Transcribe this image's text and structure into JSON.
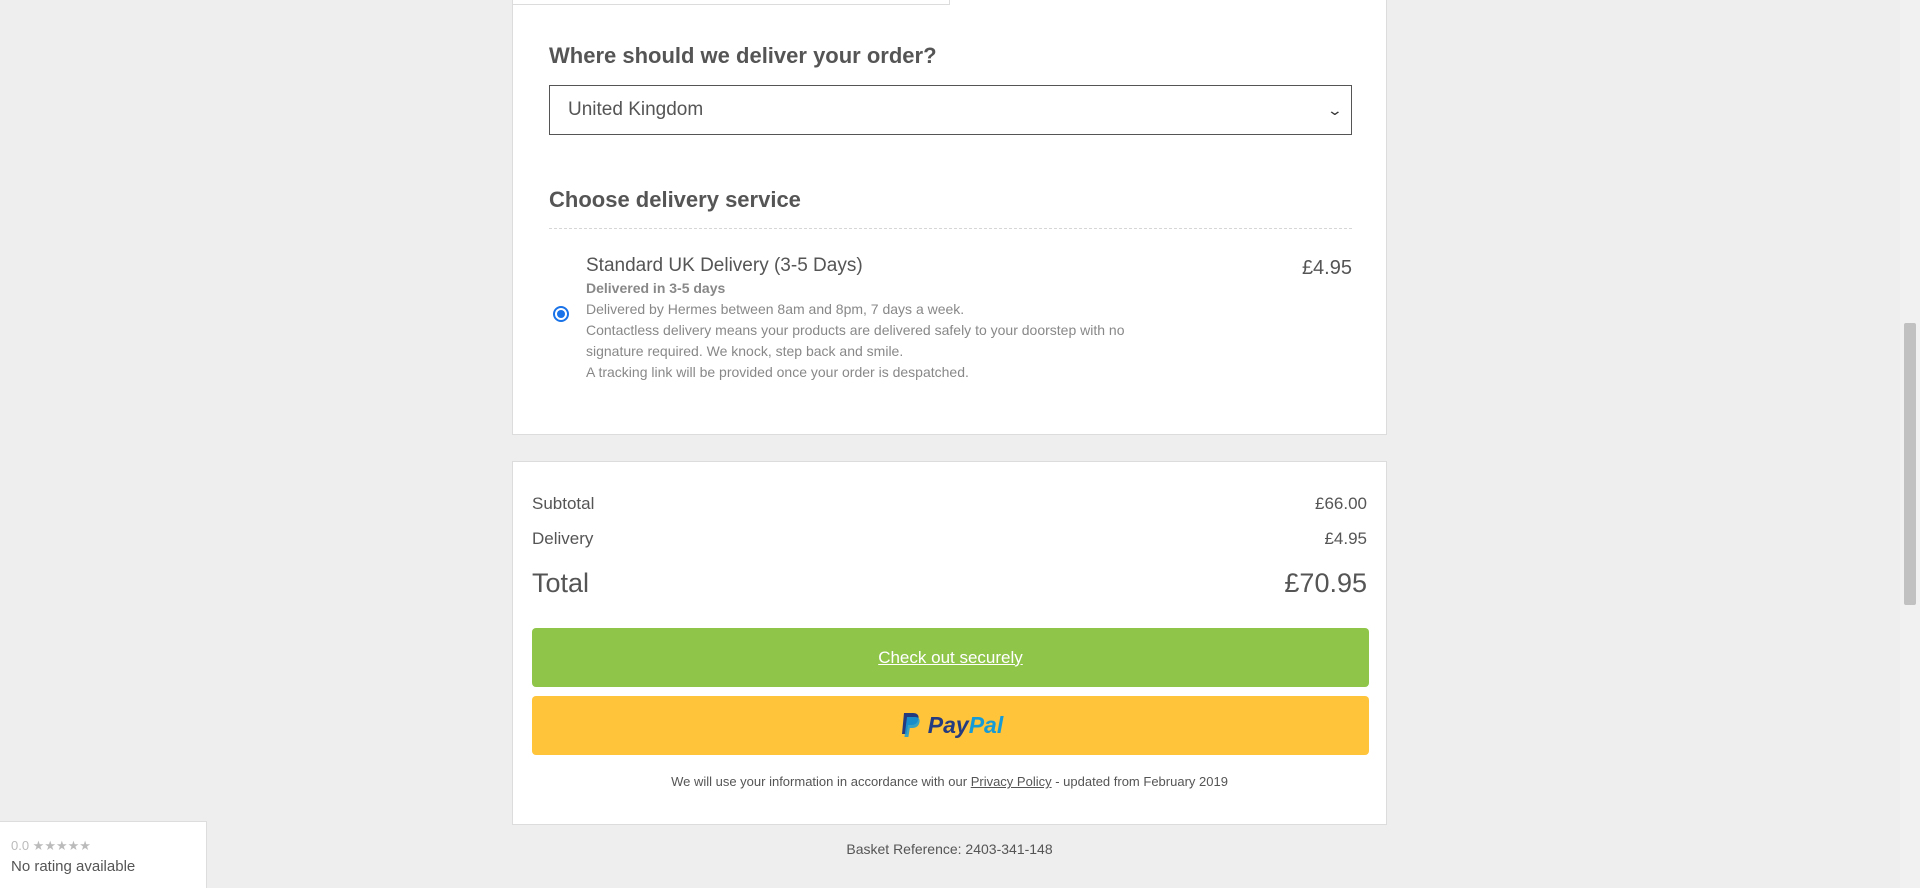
{
  "delivery": {
    "heading": "Where should we deliver your order?",
    "country_selected": "United Kingdom",
    "service_heading": "Choose delivery service",
    "service": {
      "name": "Standard UK Delivery (3-5 Days)",
      "price": "£4.95",
      "days": "Delivered in 3-5 days",
      "line1": "Delivered by Hermes between 8am and 8pm, 7 days a week.",
      "line2": "Contactless delivery means your products are delivered safely to your doorstep with no",
      "line3": "signature required. We knock, step back and smile.",
      "line4": "A tracking link will be provided once your order is despatched.",
      "selected": true
    }
  },
  "summary": {
    "subtotal_label": "Subtotal",
    "subtotal_value": "£66.00",
    "delivery_label": "Delivery",
    "delivery_value": "£4.95",
    "total_label": "Total",
    "total_value": "£70.95",
    "checkout_label": "Check out securely",
    "paypal_pay": "Pay",
    "paypal_pal": "Pal",
    "policy_prefix": "We will use your information in accordance with our ",
    "policy_link": "Privacy Policy",
    "policy_suffix": " - updated from February 2019"
  },
  "basket_reference": "Basket Reference: 2403-341-148",
  "rating": {
    "score": "0.0 ★★★★★",
    "text": "No rating available"
  },
  "colors": {
    "checkout": "#8fc549",
    "paypal_bg": "#ffc439",
    "paypal_dark": "#253b80",
    "paypal_light": "#179bd7",
    "radio": "#1a73e8"
  }
}
